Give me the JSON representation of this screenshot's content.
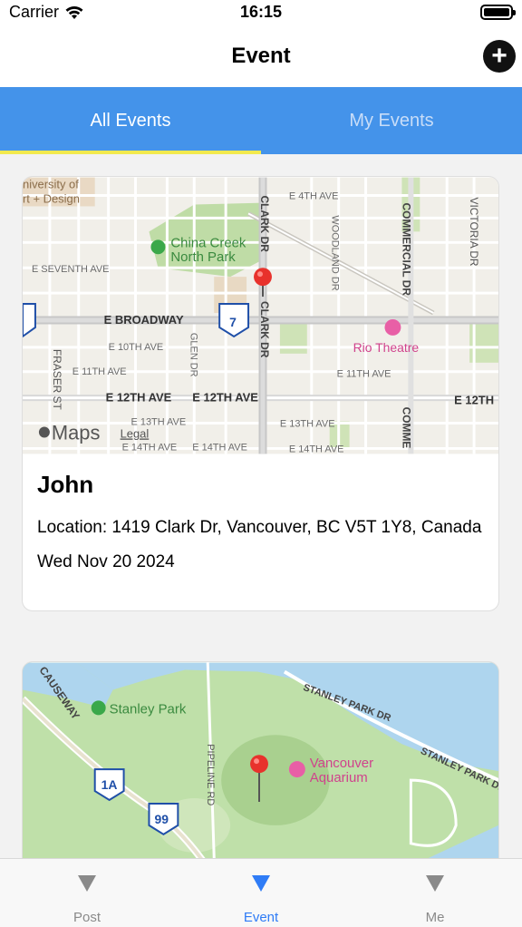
{
  "status_bar": {
    "carrier": "Carrier",
    "time": "16:15"
  },
  "nav": {
    "title": "Event",
    "add_symbol": "+"
  },
  "top_tabs": [
    {
      "label": "All Events",
      "selected": true
    },
    {
      "label": "My Events",
      "selected": false
    }
  ],
  "events": [
    {
      "title": "John",
      "location": "Location: 1419 Clark Dr, Vancouver, BC V5T 1Y8, Canada",
      "date": "Wed Nov 20 2024",
      "map": {
        "labels": {
          "university": "niversity of",
          "university2": "rt + Design",
          "e4th": "E 4TH AVE",
          "china_creek": "China Creek",
          "north_park": "North Park",
          "e7th": "E SEVENTH AVE",
          "broadway": "E BROADWAY",
          "e10th": "E 10TH AVE",
          "e11th": "E 11TH AVE",
          "e11th_b": "E 11TH AVE",
          "e12th": "E 12TH AVE",
          "e12th_b": "E 12TH AVE",
          "e12th_c": "E 12TH",
          "e13th": "E 13TH AVE",
          "e13th_b": "E 13TH AVE",
          "e14th": "E 14TH AVE",
          "e14th_b": "E 14TH AVE",
          "e14th_c": "E 14TH AVE",
          "clark_dr": "CLARK DR",
          "clark_dr_b": "CLARK DR",
          "woodland": "WOODLAND DR",
          "commercial": "COMMERCIAL DR",
          "commercial_b": "COMME",
          "victoria": "VICTORIA DR",
          "fraser": "FRASER ST",
          "glen": "GLEN DR",
          "rio": "Rio Theatre",
          "route": "7",
          "maps_brand": "Maps",
          "legal": "Legal"
        }
      }
    },
    {
      "title": "",
      "map": {
        "labels": {
          "causeway": "CAUSEWAY",
          "stanley_park": "Stanley Park",
          "stanley_park_dr": "STANLEY PARK DR",
          "stanley_park_dr_b": "STANLEY PARK DR",
          "aquarium1": "Vancouver",
          "aquarium2": "Aquarium",
          "pipeline": "PIPELINE RD",
          "route_1a": "1A",
          "route_99": "99"
        }
      }
    }
  ],
  "bottom_tabs": [
    {
      "label": "Post",
      "selected": false
    },
    {
      "label": "Event",
      "selected": true
    },
    {
      "label": "Me",
      "selected": false
    }
  ],
  "colors": {
    "header_blue": "#4493ea",
    "tab_indicator": "#f2e94e",
    "active_tab": "#2f7cf6",
    "inactive_tab": "#8a8a8a",
    "pin_red": "#e8322c"
  }
}
